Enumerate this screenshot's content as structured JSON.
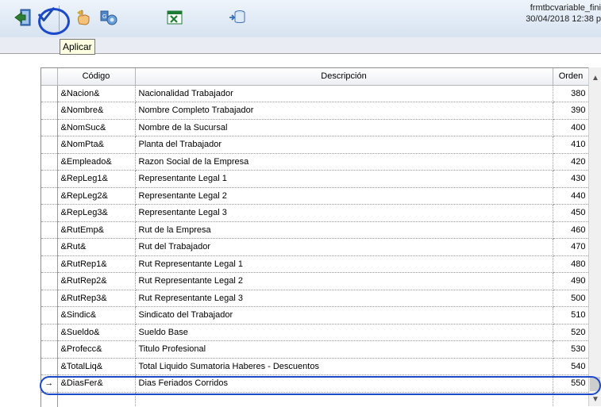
{
  "toolbar": {
    "buttons": [
      {
        "name": "exit-icon"
      },
      {
        "name": "apply-check-icon"
      },
      {
        "name": "undo-hand-icon"
      },
      {
        "name": "group-icon"
      },
      {
        "name": "excel-icon"
      },
      {
        "name": "database-icon"
      }
    ],
    "tooltip": "Aplicar"
  },
  "form": {
    "name": "frmtbcvariable_fini",
    "datetime": "30/04/2018 12:38 p"
  },
  "grid": {
    "headers": {
      "codigo": "Código",
      "descripcion": "Descripción",
      "orden": "Orden"
    },
    "rows": [
      {
        "codigo": "&Nacion&",
        "descripcion": "Nacionalidad Trabajador",
        "orden": "380"
      },
      {
        "codigo": "&Nombre&",
        "descripcion": "Nombre Completo Trabajador",
        "orden": "390"
      },
      {
        "codigo": "&NomSuc&",
        "descripcion": "Nombre de la Sucursal",
        "orden": "400"
      },
      {
        "codigo": "&NomPta&",
        "descripcion": "Planta del Trabajador",
        "orden": "410"
      },
      {
        "codigo": "&Empleado&",
        "descripcion": "Razon Social de la Empresa",
        "orden": "420"
      },
      {
        "codigo": "&RepLeg1&",
        "descripcion": "Representante Legal 1",
        "orden": "430"
      },
      {
        "codigo": "&RepLeg2&",
        "descripcion": "Representante Legal 2",
        "orden": "440"
      },
      {
        "codigo": "&RepLeg3&",
        "descripcion": "Representante Legal 3",
        "orden": "450"
      },
      {
        "codigo": "&RutEmp&",
        "descripcion": "Rut de la Empresa",
        "orden": "460"
      },
      {
        "codigo": "&Rut&",
        "descripcion": "Rut del Trabajador",
        "orden": "470"
      },
      {
        "codigo": "&RutRep1&",
        "descripcion": "Rut Representante Legal 1",
        "orden": "480"
      },
      {
        "codigo": "&RutRep2&",
        "descripcion": "Rut Representante Legal 2",
        "orden": "490"
      },
      {
        "codigo": "&RutRep3&",
        "descripcion": "Rut Representante Legal 3",
        "orden": "500"
      },
      {
        "codigo": "&Sindic&",
        "descripcion": "Sindicato del Trabajador",
        "orden": "510"
      },
      {
        "codigo": "&Sueldo&",
        "descripcion": "Sueldo Base",
        "orden": "520"
      },
      {
        "codigo": "&Profecc&",
        "descripcion": "Titulo Profesional",
        "orden": "530"
      },
      {
        "codigo": "&TotalLiq&",
        "descripcion": "Total Liquido Sumatoria Haberes - Descuentos",
        "orden": "540"
      },
      {
        "codigo": "&DiasFer&",
        "descripcion": "Dias Feriados Corridos",
        "orden": "550",
        "marker": "→"
      },
      {
        "codigo": "",
        "descripcion": "",
        "orden": ""
      }
    ]
  },
  "colors": {
    "accent": "#1b49c9",
    "tooltip_bg": "#ffffe1"
  }
}
